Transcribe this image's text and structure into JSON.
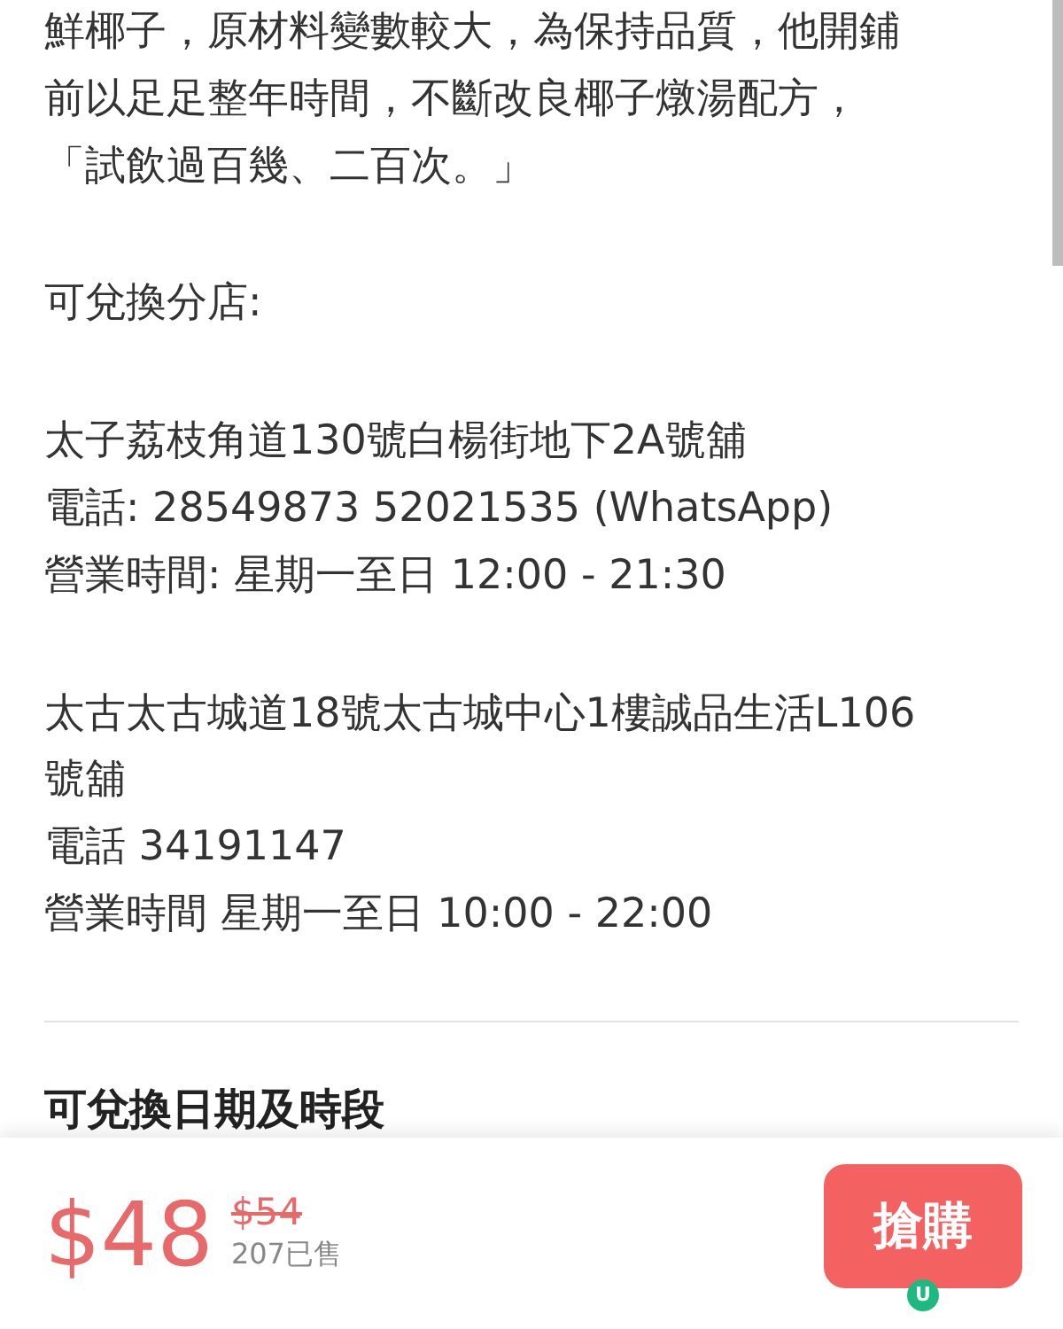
{
  "description": {
    "lines": [
      "鮮椰子，原材料變數較大，為保持品質，他開鋪",
      "前以足足整年時間，不斷改良椰子燉湯配方，",
      "「試飲過百幾、二百次。」"
    ]
  },
  "branches_heading": "可兌換分店:",
  "branches": [
    {
      "lines": [
        "太子荔枝角道130號白楊街地下2A號舖",
        "電話: 28549873 52021535 (WhatsApp)",
        "營業時間: 星期一至日 12:00 - 21:30"
      ]
    },
    {
      "lines": [
        "太古太古城道18號太古城中心1樓誠品生活L106",
        "號舖",
        "電話 34191147",
        "營業時間 星期一至日 10:00 - 22:00"
      ]
    }
  ],
  "section_title": "可兌換日期及時段",
  "purchase_bar": {
    "price": "$48",
    "original_price": "$54",
    "sold": "207已售",
    "buy_button": "搶購",
    "badge": "U"
  }
}
